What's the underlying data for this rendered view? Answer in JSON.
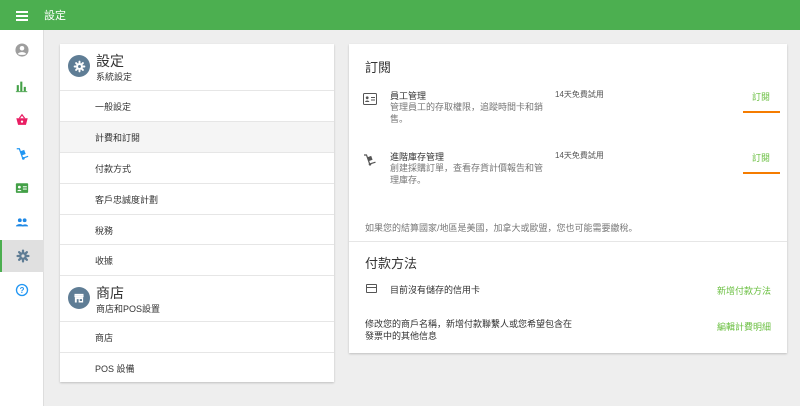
{
  "header": {
    "title": "設定"
  },
  "sidebar": {
    "icons": [
      "account-icon",
      "bar-chart-icon",
      "basket-icon",
      "dolly-icon",
      "id-card-icon",
      "people-icon",
      "settings-icon",
      "help-icon"
    ],
    "active": "settings-icon"
  },
  "left": {
    "system": {
      "title": "設定",
      "subtitle": "系統設定",
      "items": [
        "一般設定",
        "計費和訂閱",
        "付款方式",
        "客戶忠誠度計劃",
        "稅務",
        "收據"
      ],
      "active": "計費和訂閱"
    },
    "store": {
      "title": "商店",
      "subtitle": "商店和POS設置",
      "items": [
        "商店",
        "POS 設備"
      ]
    }
  },
  "subscriptions": {
    "title": "訂閱",
    "rows": [
      {
        "name": "員工管理",
        "desc": "管理員工的存取權限，追蹤時間卡和銷售。",
        "trial": "14天免費試用",
        "link": "訂閱"
      },
      {
        "name": "進階庫存管理",
        "desc": "創建採購訂單，查看存貨計價報告和管理庫存。",
        "trial": "14天免費試用",
        "link": "訂閱"
      }
    ],
    "tax_note": "如果您的結算國家/地區是美國，加拿大或歐盟，您也可能需要繳稅。"
  },
  "payment": {
    "title": "付款方法",
    "no_card": "目前沒有儲存的信用卡",
    "add_link": "新增付款方法",
    "note": "修改您的商戶名稱，新增付款聯繫人或您希望包含在發票中的其他信息",
    "edit_link": "編輯計費明細"
  },
  "colors": {
    "primary": "#4caf50",
    "link": "#6abf40",
    "underline": "#f57c00",
    "icon_blue": "#2196f3",
    "icon_pink": "#e91e63",
    "icon_green": "#43a047"
  }
}
